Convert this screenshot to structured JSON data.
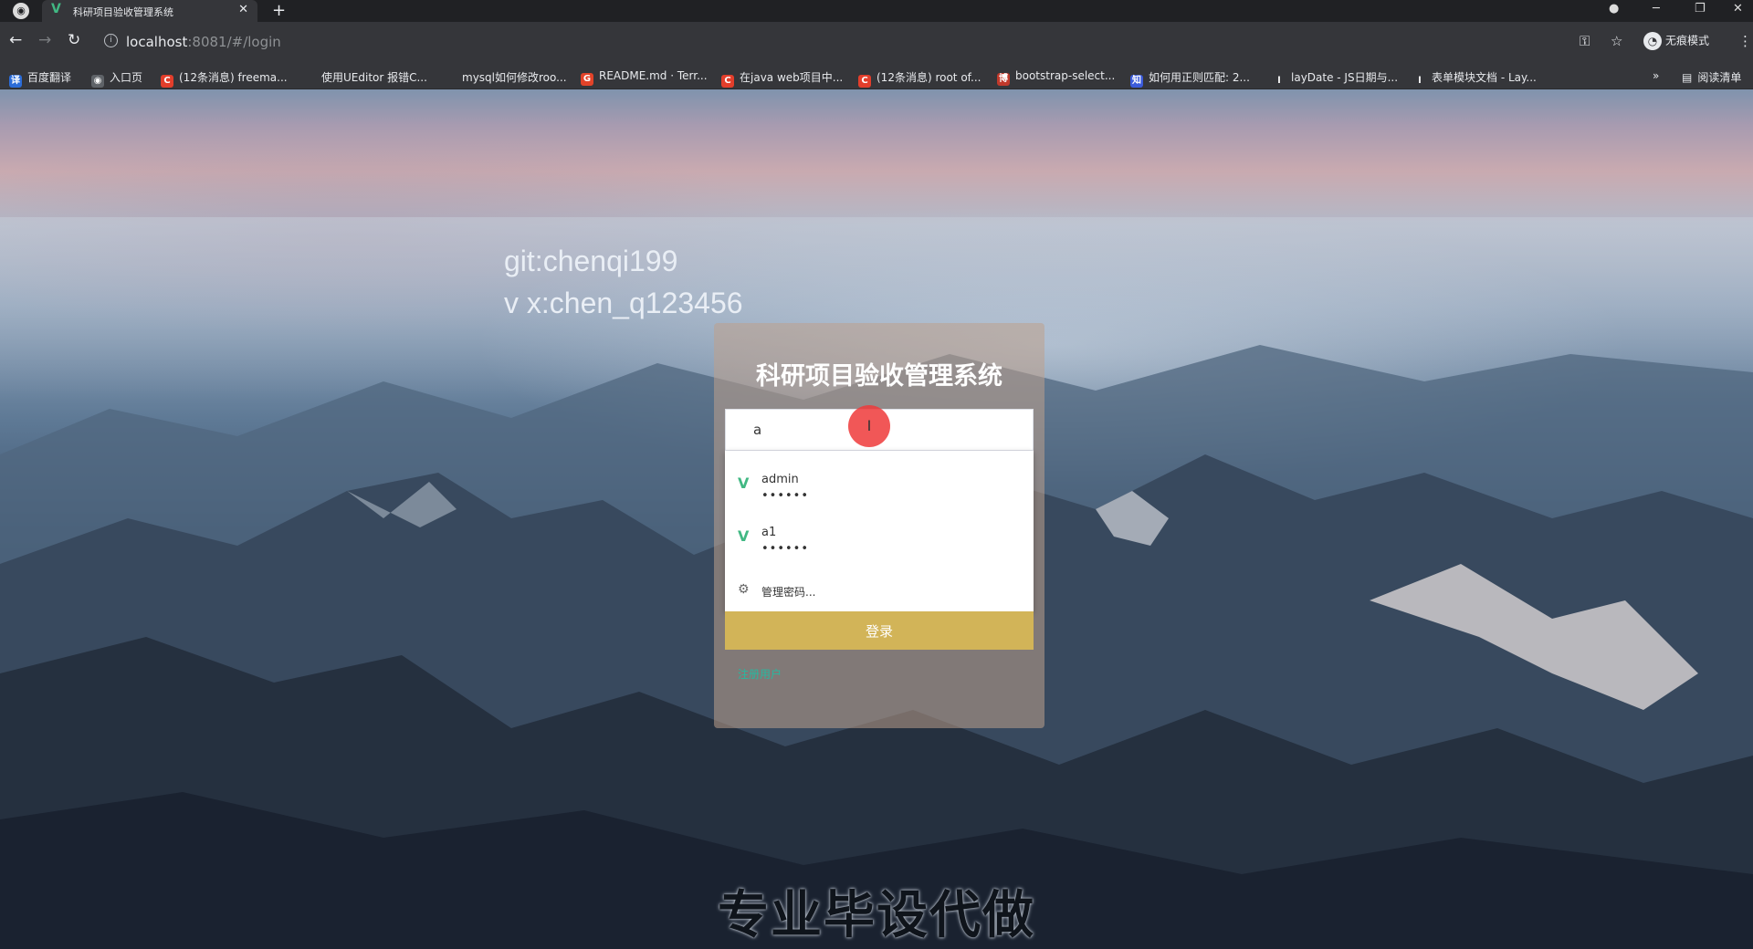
{
  "browser": {
    "tab_title": "科研项目验收管理系统",
    "tab_favicon": "V",
    "url_host": "localhost",
    "url_path": ":8081/#/login",
    "incognito_label": "无痕模式",
    "reading_list": "阅读清单",
    "bookmarks": [
      {
        "label": "百度翻译",
        "icon": "译",
        "color": "#2b6cd8"
      },
      {
        "label": "入口页",
        "icon": "◉",
        "color": "#5f6368"
      },
      {
        "label": "(12条消息) freema...",
        "icon": "C",
        "color": "#e33e2b"
      },
      {
        "label": "使用UEditor 报错C...",
        "icon": "",
        "color": "#35363a"
      },
      {
        "label": "mysql如何修改roo...",
        "icon": "",
        "color": "#35363a"
      },
      {
        "label": "README.md · Terr...",
        "icon": "G",
        "color": "#e24329"
      },
      {
        "label": "在java web项目中...",
        "icon": "C",
        "color": "#e33e2b"
      },
      {
        "label": "(12条消息) root of...",
        "icon": "C",
        "color": "#e33e2b"
      },
      {
        "label": "bootstrap-select...",
        "icon": "博",
        "color": "#c0392b"
      },
      {
        "label": "如何用正则匹配: 2...",
        "icon": "知",
        "color": "#3b5bdb"
      },
      {
        "label": "layDate - JS日期与...",
        "icon": "l",
        "color": "#35363a"
      },
      {
        "label": "表单模块文档 - Lay...",
        "icon": "l",
        "color": "#35363a"
      }
    ]
  },
  "overlay": {
    "line1": "git:chenqi199",
    "line2": "v x:chen_q123456",
    "bottom_caption": "专业毕设代做"
  },
  "login": {
    "title": "科研项目验收管理系统",
    "username_value": "a",
    "suggestions": [
      {
        "user": "admin",
        "pass": "••••••"
      },
      {
        "user": "a1",
        "pass": "••••••"
      }
    ],
    "manage_passwords": "管理密码...",
    "login_button": "登录",
    "register_link": "注册用户"
  },
  "colors": {
    "login_button": "#d2b458",
    "vue_green": "#41b883",
    "cursor_marker": "#ee3a3a"
  }
}
